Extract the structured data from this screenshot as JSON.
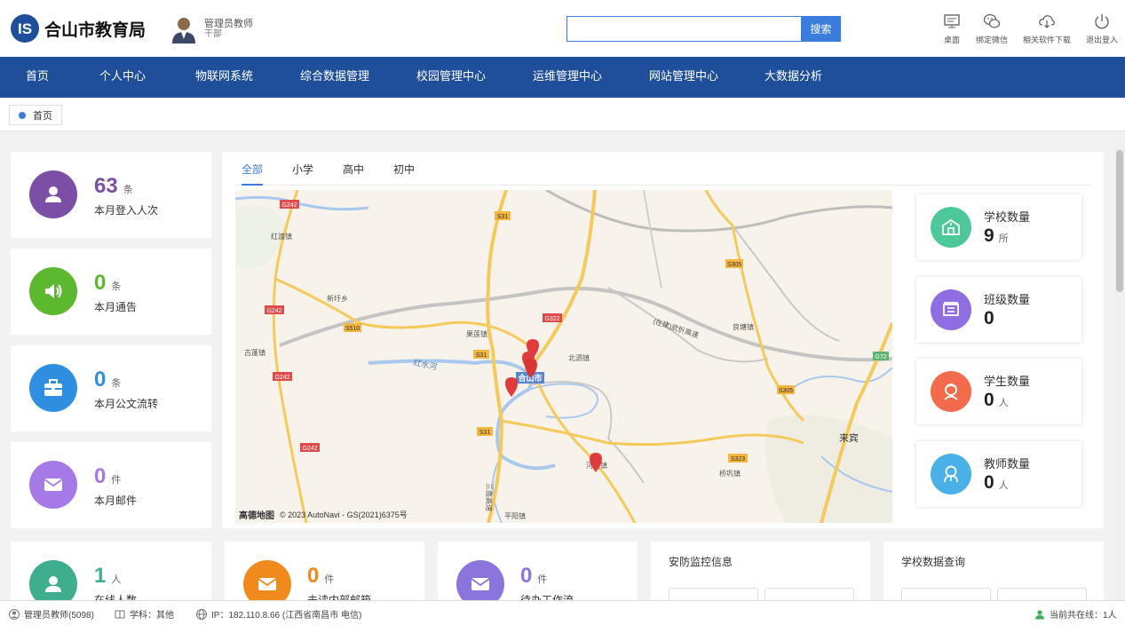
{
  "header": {
    "logo_text": "合山市教育局",
    "logo_mark": "IS",
    "user_name": "管理员教师",
    "user_role": "干部",
    "search_placeholder": "",
    "search_button": "搜索",
    "tools": [
      {
        "icon": "desktop-icon",
        "label": "桌面"
      },
      {
        "icon": "wechat-icon",
        "label": "绑定微信"
      },
      {
        "icon": "cloud-download-icon",
        "label": "相关软件下载"
      },
      {
        "icon": "power-icon",
        "label": "退出登入"
      }
    ]
  },
  "nav": {
    "items": [
      "首页",
      "个人中心",
      "物联网系统",
      "综合数据管理",
      "校园管理中心",
      "运维管理中心",
      "网站管理中心",
      "大数据分析"
    ]
  },
  "breadcrumb": {
    "label": "首页"
  },
  "stats_left": [
    {
      "value": "63",
      "unit": "条",
      "label": "本月登入人次",
      "color": "#7c4fa6",
      "icon": "user-icon"
    },
    {
      "value": "0",
      "unit": "条",
      "label": "本月通告",
      "color": "#5cb82f",
      "icon": "speaker-icon"
    },
    {
      "value": "0",
      "unit": "条",
      "label": "本月公文流转",
      "color": "#2f8ee0",
      "icon": "briefcase-icon"
    },
    {
      "value": "0",
      "unit": "件",
      "label": "本月邮件",
      "color": "#a57ae6",
      "icon": "mail-icon"
    }
  ],
  "stats_bottom": [
    {
      "value": "1",
      "unit": "人",
      "label": "在线人数",
      "color": "#3fae8e",
      "icon": "person-check-icon"
    },
    {
      "value": "0",
      "unit": "件",
      "label": "未读内部邮箱",
      "color": "#f08a1c",
      "icon": "mail-icon"
    },
    {
      "value": "0",
      "unit": "件",
      "label": "待办工作流",
      "color": "#8b74dc",
      "icon": "mail-icon"
    }
  ],
  "tabs": [
    "全部",
    "小学",
    "高中",
    "初中"
  ],
  "active_tab": 0,
  "map": {
    "credit_brand": "高德地图",
    "credit_text": "© 2023 AutoNavi - GS(2021)6375号",
    "labels": [
      "G242",
      "S31",
      "红渡镇",
      "新圩乡",
      "G242",
      "S510",
      "古蓬镇",
      "G242",
      "红水河",
      "果莲镇",
      "S31",
      "合山市",
      "北泗镇",
      "G322",
      "良塘镇",
      "S305",
      "S305",
      "G72",
      "来宾",
      "S323",
      "桥巩镇",
      "G242",
      "S31",
      "三南高速",
      "平阳镇",
      "河里镇",
      "(在建)武忻高速"
    ]
  },
  "right_stats": [
    {
      "label": "学校数量",
      "value": "9",
      "unit": "所",
      "color": "#4ec79a",
      "icon": "school-icon"
    },
    {
      "label": "班级数量",
      "value": "0",
      "unit": "",
      "color": "#8e6ee0",
      "icon": "class-icon"
    },
    {
      "label": "学生数量",
      "value": "0",
      "unit": "人",
      "color": "#f26b4d",
      "icon": "student-icon"
    },
    {
      "label": "教师数量",
      "value": "0",
      "unit": "人",
      "color": "#4ab0e8",
      "icon": "teacher-icon"
    }
  ],
  "panels": {
    "security": "安防监控信息",
    "school_query": "学校数据查询"
  },
  "footer": {
    "user": "管理员教师(5098)",
    "subject": "学科：其他",
    "ip": "IP：182.110.8.66 (江西省南昌市 电信)",
    "online": "当前共在线：1人"
  }
}
